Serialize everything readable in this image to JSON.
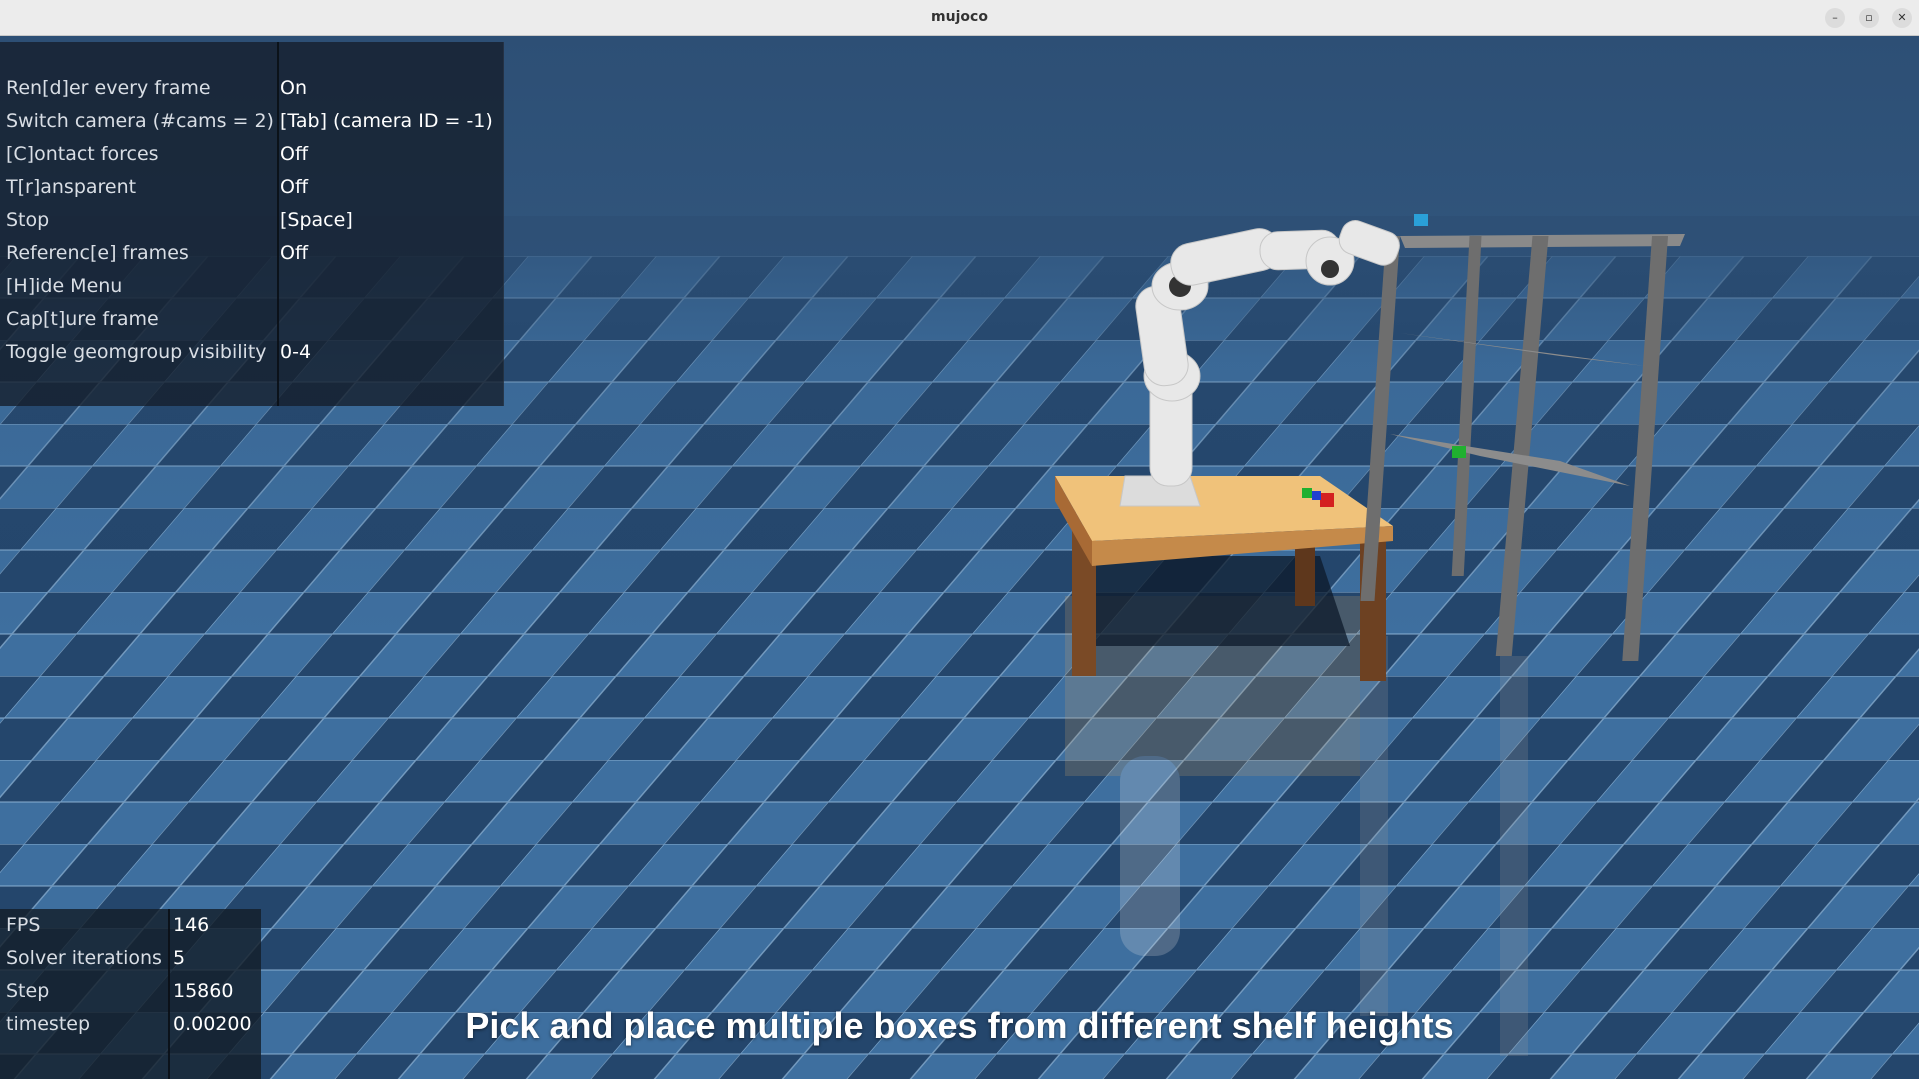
{
  "window": {
    "title": "mujoco"
  },
  "window_controls": {
    "minimize": "–",
    "maximize": "▫",
    "close": "✕"
  },
  "menu": {
    "items": [
      {
        "key": "Ren[d]er every frame",
        "value": "On"
      },
      {
        "key": "Switch camera (#cams = 2)",
        "value": "[Tab] (camera ID = -1)"
      },
      {
        "key": "[C]ontact forces",
        "value": "Off"
      },
      {
        "key": "T[r]ansparent",
        "value": "Off"
      },
      {
        "key": "Stop",
        "value": "[Space]"
      },
      {
        "key": "Referenc[e] frames",
        "value": "Off"
      },
      {
        "key": "[H]ide Menu",
        "value": ""
      },
      {
        "key": "Cap[t]ure frame",
        "value": ""
      },
      {
        "key": "Toggle geomgroup visibility",
        "value": "0-4"
      }
    ]
  },
  "stats": {
    "items": [
      {
        "key": "FPS",
        "value": "146"
      },
      {
        "key": "Solver iterations",
        "value": "5"
      },
      {
        "key": "Step",
        "value": "15860"
      },
      {
        "key": "timestep",
        "value": "0.00200"
      }
    ]
  },
  "caption": "Pick and place multiple boxes from different shelf heights",
  "scene": {
    "floor_color_light": "#4a7eb0",
    "floor_color_dark": "#1f3f63",
    "sky_color": "#3a6590",
    "table_top_color": "#f0c27a",
    "table_leg_color": "#7a4a26",
    "shelf_color": "#6e6e6e",
    "robot_color": "#e8e8e8",
    "box_colors": [
      "#d42020",
      "#20b030",
      "#2040d0"
    ]
  }
}
